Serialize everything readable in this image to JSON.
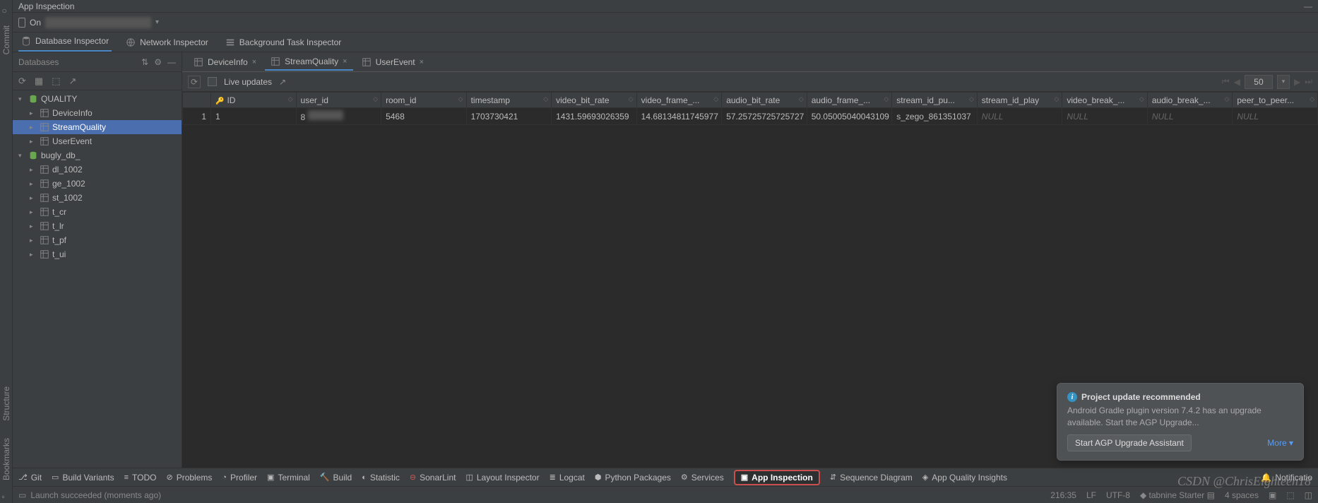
{
  "title": "App Inspection",
  "device": {
    "prefix": "On"
  },
  "inspector_tabs": [
    {
      "id": "db",
      "label": "Database Inspector",
      "active": true
    },
    {
      "id": "net",
      "label": "Network Inspector",
      "active": false
    },
    {
      "id": "bg",
      "label": "Background Task Inspector",
      "active": false
    }
  ],
  "db_panel": {
    "title": "Databases",
    "tree": [
      {
        "type": "db",
        "label": "QUALITY",
        "expanded": true,
        "indent": 0
      },
      {
        "type": "table",
        "label": "DeviceInfo",
        "indent": 1
      },
      {
        "type": "table",
        "label": "StreamQuality",
        "indent": 1,
        "selected": true
      },
      {
        "type": "table",
        "label": "UserEvent",
        "indent": 1
      },
      {
        "type": "db",
        "label": "bugly_db_",
        "expanded": true,
        "indent": 0
      },
      {
        "type": "table",
        "label": "dl_1002",
        "indent": 1
      },
      {
        "type": "table",
        "label": "ge_1002",
        "indent": 1
      },
      {
        "type": "table",
        "label": "st_1002",
        "indent": 1
      },
      {
        "type": "table",
        "label": "t_cr",
        "indent": 1
      },
      {
        "type": "table",
        "label": "t_lr",
        "indent": 1
      },
      {
        "type": "table",
        "label": "t_pf",
        "indent": 1
      },
      {
        "type": "table",
        "label": "t_ui",
        "indent": 1
      }
    ]
  },
  "data_tabs": [
    {
      "label": "DeviceInfo",
      "active": false
    },
    {
      "label": "StreamQuality",
      "active": true
    },
    {
      "label": "UserEvent",
      "active": false
    }
  ],
  "data_toolbar": {
    "live_updates_label": "Live updates",
    "page_size": "50"
  },
  "columns": [
    "ID",
    "user_id",
    "room_id",
    "timestamp",
    "video_bit_rate",
    "video_frame_...",
    "audio_bit_rate",
    "audio_frame_...",
    "stream_id_pu...",
    "stream_id_play",
    "video_break_...",
    "audio_break_...",
    "peer_to_peer..."
  ],
  "rows": [
    {
      "rownum": "1",
      "ID": "1",
      "user_id": "8",
      "user_id_blur": true,
      "room_id": "5468",
      "timestamp": "1703730421",
      "video_bit_rate": "1431.59693026359",
      "video_frame": "14.68134811745977",
      "audio_bit_rate": "57.25725725725727",
      "audio_frame": "50.05005040043109",
      "stream_id_pu": "s_zego_861351037",
      "stream_id_play": "NULL",
      "video_break": "NULL",
      "audio_break": "NULL",
      "peer_to_peer": "NULL"
    }
  ],
  "notification": {
    "title": "Project update recommended",
    "body": "Android Gradle plugin version 7.4.2 has an upgrade available. Start the AGP Upgrade...",
    "primary_action": "Start AGP Upgrade Assistant",
    "more_label": "More"
  },
  "bottom_tools": [
    {
      "label": "Git",
      "icon": "⎇"
    },
    {
      "label": "Build Variants",
      "icon": "▭"
    },
    {
      "label": "TODO",
      "icon": "≡"
    },
    {
      "label": "Problems",
      "icon": "⊘"
    },
    {
      "label": "Profiler",
      "icon": "◔"
    },
    {
      "label": "Terminal",
      "icon": "▣"
    },
    {
      "label": "Build",
      "icon": "🔨"
    },
    {
      "label": "Statistic",
      "icon": "◐"
    },
    {
      "label": "SonarLint",
      "icon": "⊖",
      "color": "#d9534f"
    },
    {
      "label": "Layout Inspector",
      "icon": "◫"
    },
    {
      "label": "Logcat",
      "icon": "≣"
    },
    {
      "label": "Python Packages",
      "icon": "⬢"
    },
    {
      "label": "Services",
      "icon": "⚙"
    },
    {
      "label": "App Inspection",
      "icon": "▣",
      "active": true
    },
    {
      "label": "Sequence Diagram",
      "icon": "⇵"
    },
    {
      "label": "App Quality Insights",
      "icon": "◈"
    }
  ],
  "bottom_right": {
    "notifications": "Notificatio"
  },
  "status": {
    "message": "Launch succeeded (moments ago)",
    "pos": "216:35",
    "line_sep": "LF",
    "encoding": "UTF-8",
    "tabnine": "tabnine Starter",
    "indent": "4 spaces"
  },
  "gutter": {
    "commit": "Commit",
    "structure": "Structure",
    "bookmarks": "Bookmarks"
  },
  "watermark": "CSDN @ChrisEighteen18"
}
